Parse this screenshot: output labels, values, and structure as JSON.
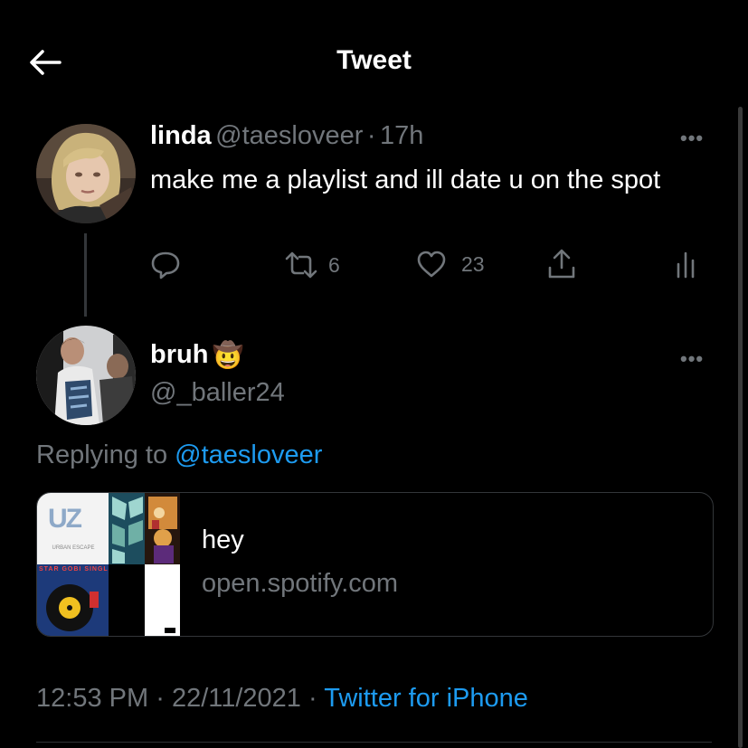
{
  "header": {
    "title": "Tweet"
  },
  "original_tweet": {
    "display_name": "linda",
    "handle": "@taesloveer",
    "separator": "·",
    "time_ago": "17h",
    "text": "make me a playlist and ill date u on the spot",
    "actions": {
      "reply_count": "",
      "retweet_count": "6",
      "like_count": "23"
    }
  },
  "reply_tweet": {
    "display_name": "bruh",
    "emoji": "🤠",
    "handle": "@_baller24",
    "replying_prefix": "Replying to",
    "replying_to": "@taesloveer",
    "card": {
      "title": "hey",
      "domain": "open.spotify.com",
      "album_texts": [
        "UZ",
        "URBAN ESCAPE",
        "STAR GOBI SINGLES"
      ]
    },
    "meta": {
      "time": "12:53 PM",
      "dot1": "·",
      "date": "22/11/2021",
      "dot2": "·",
      "source": "Twitter for iPhone"
    }
  },
  "colors": {
    "background": "#000000",
    "text": "#e7e9ea",
    "secondary": "#71767b",
    "accent": "#1d9bf0",
    "border": "#333639"
  },
  "icons": [
    "back-arrow-icon",
    "reply-icon",
    "retweet-icon",
    "like-icon",
    "share-icon",
    "analytics-icon",
    "more-icon"
  ]
}
